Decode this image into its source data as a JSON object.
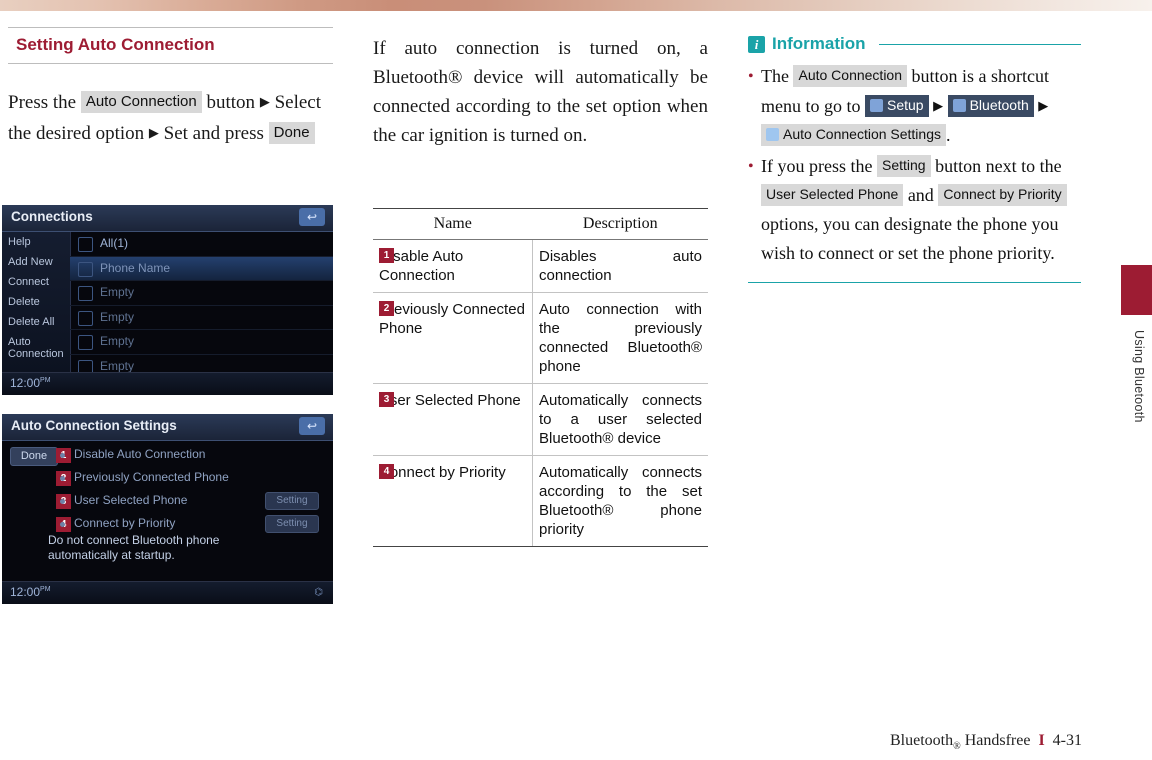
{
  "section": {
    "title": "Setting Auto Connection"
  },
  "instruction": {
    "line1_pre": "Press the",
    "button_auto_connection": "Auto Connection",
    "line1_post": "button",
    "arrow": "▶",
    "line2": "Select the desired option",
    "line2_post": "Set and",
    "line3_pre": "press",
    "button_done": "Done"
  },
  "screenshot1": {
    "title": "Connections",
    "back_icon": "↩",
    "left_menu": [
      "Help",
      "Add New",
      "Connect",
      "Delete",
      "Delete All",
      "Auto Connection"
    ],
    "rows": [
      {
        "label": "All(1)",
        "type": "header"
      },
      {
        "label": "Phone Name",
        "type": "highlight"
      },
      {
        "label": "Empty",
        "type": "normal"
      },
      {
        "label": "Empty",
        "type": "normal"
      },
      {
        "label": "Empty",
        "type": "normal"
      },
      {
        "label": "Empty",
        "type": "normal"
      }
    ],
    "clock": "12:00",
    "clock_suffix": "PM"
  },
  "screenshot2": {
    "title": "Auto Connection Settings",
    "back_icon": "↩",
    "done_label": "Done",
    "rows": [
      {
        "num": "1",
        "label": "Disable Auto Connection",
        "setting": ""
      },
      {
        "num": "2",
        "label": "Previously Connected Phone",
        "setting": ""
      },
      {
        "num": "3",
        "label": "User Selected Phone",
        "setting": "Setting"
      },
      {
        "num": "4",
        "label": "Connect by Priority",
        "setting": "Setting"
      }
    ],
    "note_line1": "Do not connect Bluetooth phone",
    "note_line2": "automatically at startup.",
    "clock": "12:00",
    "clock_suffix": "PM"
  },
  "body_text": {
    "paragraph": "If auto connection is turned on, a Bluetooth® device will automatically be connected according to the set option when the car ignition is turned on."
  },
  "table": {
    "headers": [
      "Name",
      "Description"
    ],
    "rows": [
      {
        "num": "1",
        "name": "Disable Auto Connection",
        "description": "Disables auto connection"
      },
      {
        "num": "2",
        "name": "Previously Connected Phone",
        "description": "Auto connection with the previously connected Bluetooth® phone"
      },
      {
        "num": "3",
        "name": "User Selected Phone",
        "description": "Automatically connects to a user selected Bluetooth® device"
      },
      {
        "num": "4",
        "name": "Connect by Priority",
        "description": "Automatically connects according to the set Bluetooth® phone priority"
      }
    ]
  },
  "information": {
    "icon": "i",
    "title": "Information",
    "bullet1": {
      "pre": "The",
      "btn_auto_connection": "Auto Connection",
      "mid1": "button is a shortcut menu to go to",
      "btn_setup": "Setup",
      "arrow": "▶",
      "btn_bluetooth": "Bluetooth",
      "btn_auto_connection_settings": "Auto Connection Settings",
      "period": "."
    },
    "bullet2": {
      "pre": "If you press the",
      "btn_setting": "Setting",
      "mid1": "button next to the",
      "btn_user_selected_phone": "User Selected Phone",
      "and": "and",
      "btn_connect_by_priority": "Connect by Priority",
      "post": "options, you can designate the phone you wish to connect or set the phone priority."
    }
  },
  "side_label": "Using Bluetooth",
  "footer": {
    "text": "Bluetooth",
    "reg": "®",
    "suffix": "Handsfree",
    "bar": "I",
    "page": "4-31"
  }
}
